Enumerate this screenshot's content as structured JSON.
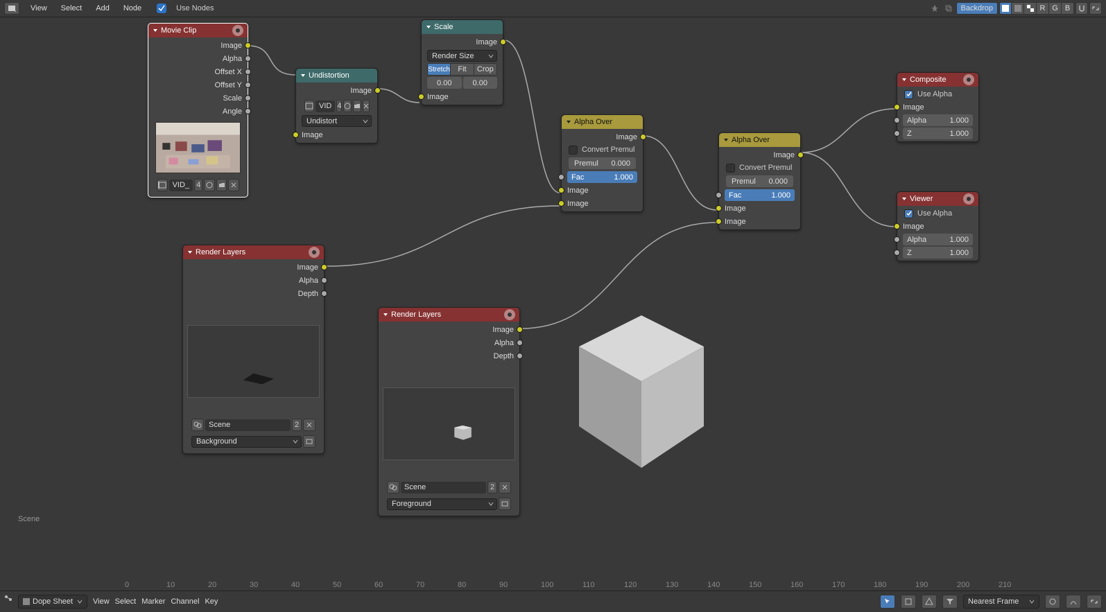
{
  "topbar": {
    "menus": [
      "View",
      "Select",
      "Add",
      "Node"
    ],
    "use_nodes": "Use Nodes",
    "backdrop": "Backdrop",
    "channels": [
      "R",
      "G",
      "B"
    ]
  },
  "nodes": {
    "movie_clip": {
      "title": "Movie Clip",
      "outputs": [
        "Image",
        "Alpha",
        "Offset X",
        "Offset Y",
        "Scale",
        "Angle"
      ],
      "file": "VID_",
      "file_users": "4"
    },
    "undistortion": {
      "title": "Undistortion",
      "out_image": "Image",
      "file": "VID",
      "file_users": "4",
      "mode": "Undistort",
      "in_image": "Image"
    },
    "scale": {
      "title": "Scale",
      "out_image": "Image",
      "mode": "Render Size",
      "opts": [
        "Stretch",
        "Fit",
        "Crop"
      ],
      "v1": "0.00",
      "v2": "0.00",
      "in_image": "Image"
    },
    "alpha1": {
      "title": "Alpha Over",
      "out_image": "Image",
      "convert": "Convert Premul",
      "premul_l": "Premul",
      "premul_v": "0.000",
      "fac_l": "Fac",
      "fac_v": "1.000",
      "in1": "Image",
      "in2": "Image"
    },
    "alpha2": {
      "title": "Alpha Over",
      "out_image": "Image",
      "convert": "Convert Premul",
      "premul_l": "Premul",
      "premul_v": "0.000",
      "fac_l": "Fac",
      "fac_v": "1.000",
      "in1": "Image",
      "in2": "Image"
    },
    "rl1": {
      "title": "Render Layers",
      "outs": [
        "Image",
        "Alpha",
        "Depth"
      ],
      "scene": "Scene",
      "scene_users": "2",
      "layer": "Background"
    },
    "rl2": {
      "title": "Render Layers",
      "outs": [
        "Image",
        "Alpha",
        "Depth"
      ],
      "scene": "Scene",
      "scene_users": "2",
      "layer": "Foreground"
    },
    "composite": {
      "title": "Composite",
      "use_alpha": "Use Alpha",
      "in_image": "Image",
      "alpha_l": "Alpha",
      "alpha_v": "1.000",
      "z_l": "Z",
      "z_v": "1.000"
    },
    "viewer": {
      "title": "Viewer",
      "use_alpha": "Use Alpha",
      "in_image": "Image",
      "alpha_l": "Alpha",
      "alpha_v": "1.000",
      "z_l": "Z",
      "z_v": "1.000"
    }
  },
  "scene_label": "Scene",
  "bottombar": {
    "dopesheet": "Dope Sheet",
    "menus": [
      "View",
      "Select",
      "Marker",
      "Channel",
      "Key"
    ],
    "nearest": "Nearest Frame"
  },
  "ruler": [
    "0",
    "10",
    "20",
    "30",
    "40",
    "50",
    "60",
    "70",
    "80",
    "90",
    "100",
    "110",
    "120",
    "130",
    "140",
    "150",
    "160",
    "170",
    "180",
    "190",
    "200",
    "210"
  ]
}
